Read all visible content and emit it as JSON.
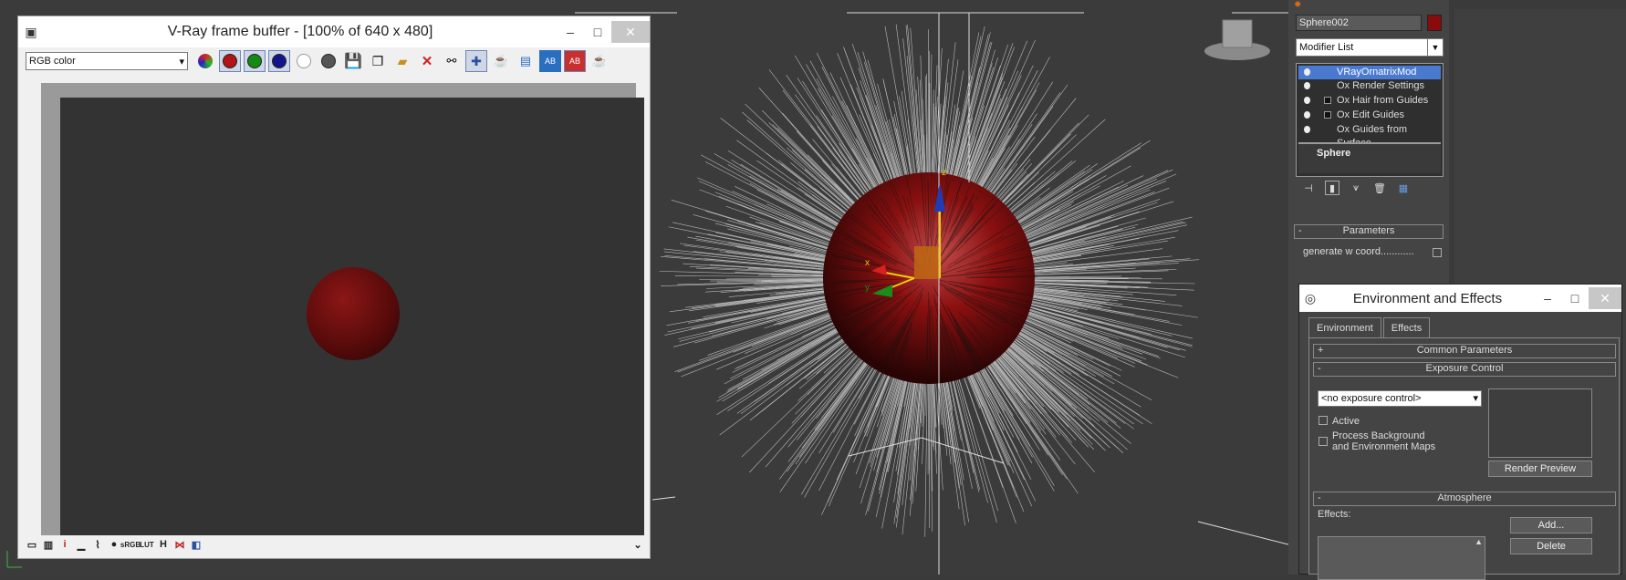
{
  "vfb": {
    "title": "V-Ray frame buffer - [100% of 640 x 480]",
    "channel": "RGB color",
    "min": "–",
    "max": "□",
    "close": "✕"
  },
  "cmd": {
    "object_name": "Sphere002",
    "object_color": "#8a0b0b",
    "modifier_list": "Modifier List",
    "stack": [
      {
        "label": "VRayOrnatrixMod",
        "selected": true
      },
      {
        "label": "Ox Render Settings"
      },
      {
        "label": "Ox Hair from Guides"
      },
      {
        "label": "Ox Edit Guides"
      },
      {
        "label": "Ox Guides from Surface"
      }
    ],
    "base": "Sphere",
    "params_title": "Parameters",
    "params_sign": "-",
    "gen_w": "generate w coord............"
  },
  "env": {
    "title": "Environment and Effects",
    "min": "–",
    "max": "□",
    "close": "✕",
    "tabs": [
      "Environment",
      "Effects"
    ],
    "common": "Common Parameters",
    "exposure": "Exposure Control",
    "exposure_value": "<no exposure control>",
    "active": "Active",
    "process_bg_1": "Process Background",
    "process_bg_2": "and Environment Maps",
    "render_preview": "Render Preview",
    "atmosphere": "Atmosphere",
    "effects_label": "Effects:",
    "add": "Add...",
    "delete": "Delete",
    "plus": "+",
    "minus": "-"
  },
  "colors": {
    "accent": "#4a7ad0",
    "sphere": "#8a0b0b"
  }
}
